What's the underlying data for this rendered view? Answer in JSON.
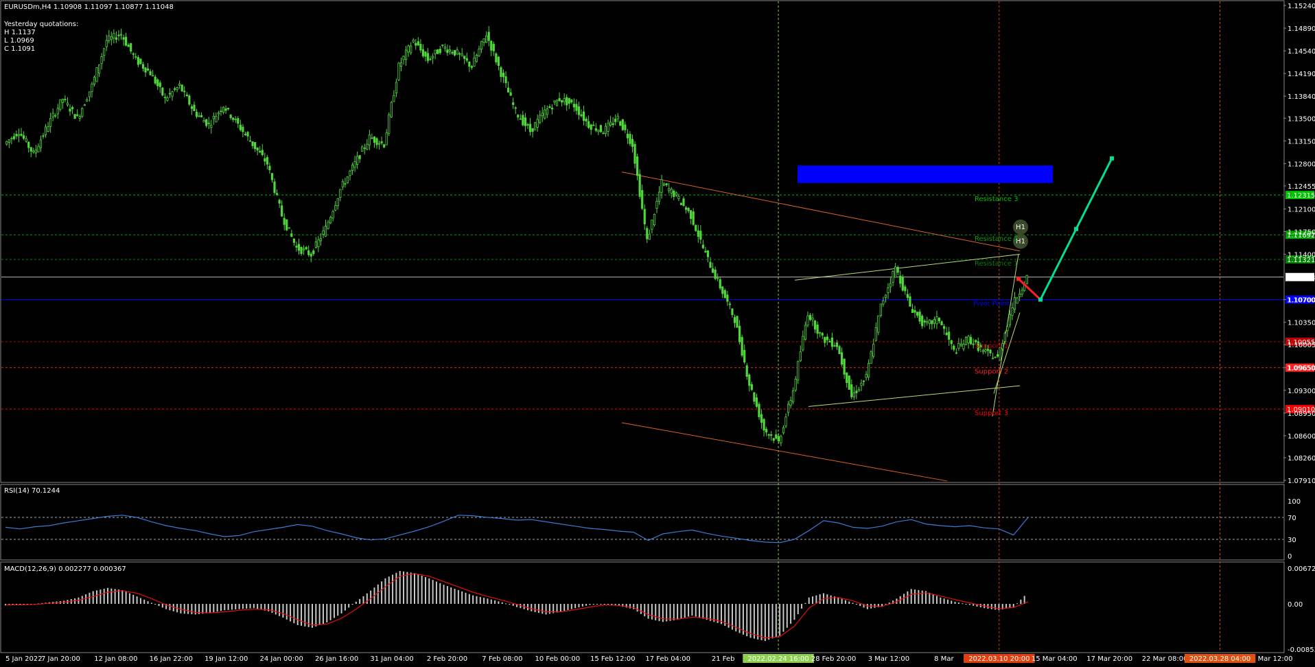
{
  "header": {
    "symbol_line": "EURUSDm,H4  1.10908 1.11097 1.10877 1.11048",
    "yesterday_title": "Yesterday quotations:",
    "yesterday_high": "H 1.1137",
    "yesterday_low": "L 1.0969",
    "yesterday_close": "C 1.1091"
  },
  "chart_data": [
    {
      "type": "candlestick",
      "symbol": "EURUSDm",
      "timeframe": "H4",
      "ohlc_last": {
        "open": 1.10908,
        "high": 1.11097,
        "low": 1.10877,
        "close": 1.11048
      },
      "current_price_label": "1.11048",
      "ylim": [
        1.0791,
        1.1524
      ],
      "price_ticks": [
        "1.15240",
        "1.14890",
        "1.14540",
        "1.14190",
        "1.13840",
        "1.13500",
        "1.13150",
        "1.12800",
        "1.12455",
        "1.12100",
        "1.11750",
        "1.11400",
        "1.11048",
        "1.10700",
        "1.10350",
        "1.10005",
        "1.09650",
        "1.09300",
        "1.08950",
        "1.08600",
        "1.08260",
        "1.07910"
      ],
      "time_ticks": [
        "5 Jan 2022",
        "7 Jan 20:00",
        "12 Jan 08:00",
        "16 Jan 22:00",
        "19 Jan 12:00",
        "24 Jan 00:00",
        "26 Jan 16:00",
        "31 Jan 04:00",
        "2 Feb 20:00",
        "7 Feb 08:00",
        "10 Feb 00:00",
        "15 Feb 12:00",
        "17 Feb 04:00",
        "21 Feb",
        "2022.02.24 16:00",
        "28 Feb 20:00",
        "3 Mar 12:00",
        "8 Mar",
        "2022.03.10 20:00",
        "15 Mar 04:00",
        "17 Mar 20:00",
        "22 Mar 08:00",
        "2022.03.28 04:00",
        "Mar 12:00"
      ],
      "close_series": [
        1.131,
        1.133,
        1.1295,
        1.134,
        1.138,
        1.135,
        1.14,
        1.147,
        1.148,
        1.144,
        1.142,
        1.138,
        1.14,
        1.136,
        1.134,
        1.137,
        1.134,
        1.131,
        1.128,
        1.12,
        1.115,
        1.114,
        1.118,
        1.124,
        1.128,
        1.132,
        1.131,
        1.143,
        1.147,
        1.144,
        1.146,
        1.145,
        1.143,
        1.148,
        1.142,
        1.136,
        1.133,
        1.136,
        1.138,
        1.137,
        1.134,
        1.133,
        1.135,
        1.131,
        1.116,
        1.125,
        1.123,
        1.12,
        1.114,
        1.109,
        1.104,
        1.094,
        1.087,
        1.085,
        1.093,
        1.105,
        1.101,
        1.1,
        1.092,
        1.095,
        1.106,
        1.112,
        1.106,
        1.103,
        1.104,
        1.099,
        1.101,
        1.099,
        1.098,
        1.106,
        1.1105
      ],
      "price_levels": [
        {
          "label": "Resistance 3",
          "value": 1.12315,
          "color": "#00c000"
        },
        {
          "label": "Resistance 2",
          "value": 1.117,
          "color": "#00a000"
        },
        {
          "label": "Resistance 1",
          "value": 1.1132,
          "color": "#008000"
        },
        {
          "label": "Pivot Point",
          "value": 1.107,
          "color": "#0000ff"
        },
        {
          "label": "Support 1",
          "value": 1.1005,
          "color": "#c00000"
        },
        {
          "label": "Support 2",
          "value": 1.0965,
          "color": "#ff2020"
        },
        {
          "label": "Support 3",
          "value": 1.0901,
          "color": "#ff0000"
        }
      ],
      "level_tags": [
        "1.12315",
        "1.11692",
        "1.11321",
        "1.10700",
        "1.10055",
        "1.09650",
        "1.09010"
      ],
      "zone_marker_label": "H1",
      "highlight_zone": {
        "from_time": "2022.02.24 16:00",
        "to_time": "2022.03.10 20:00",
        "price_low": 1.125,
        "price_high": 1.1277,
        "color": "#0000ff"
      },
      "forecast_path": [
        {
          "time": "now",
          "price": 1.1102,
          "color": "#ff2020"
        },
        {
          "time": "next",
          "price": 1.107,
          "color": "#ff2020"
        },
        {
          "time": "later",
          "price": 1.1288,
          "color": "#00e090"
        }
      ],
      "grid": false
    },
    {
      "type": "line",
      "title": "RSI(14) 70.1244",
      "ylim": [
        0,
        100
      ],
      "ticks": [
        "100",
        "70",
        "30",
        "0"
      ],
      "levels": [
        70,
        30
      ],
      "series": [
        {
          "values": [
            52,
            49,
            53,
            55,
            60,
            64,
            68,
            72,
            74,
            70,
            62,
            55,
            50,
            46,
            40,
            35,
            37,
            44,
            48,
            52,
            57,
            54,
            46,
            40,
            33,
            29,
            31,
            38,
            45,
            53,
            63,
            74,
            73,
            70,
            68,
            65,
            66,
            62,
            58,
            54,
            50,
            48,
            45,
            43,
            28,
            40,
            44,
            47,
            41,
            36,
            32,
            28,
            25,
            24,
            30,
            46,
            64,
            60,
            52,
            50,
            54,
            62,
            66,
            58,
            55,
            53,
            55,
            51,
            49,
            38,
            70
          ],
          "color": "#3a7bd5"
        }
      ]
    },
    {
      "type": "bar",
      "title": "MACD(12,26,9) 0.002277 0.000367",
      "ylim": [
        -0.008533,
        0.006723
      ],
      "ticks": [
        "0.006723",
        "0.00",
        "-0.008533"
      ],
      "series": [
        {
          "name": "histogram",
          "values": [
            -0.0003,
            -0.0002,
            0.0,
            0.0003,
            0.0006,
            0.0012,
            0.0024,
            0.003,
            0.0026,
            0.0014,
            0.0002,
            -0.001,
            -0.0018,
            -0.002,
            -0.0017,
            -0.0012,
            -0.001,
            -0.0008,
            -0.0014,
            -0.0026,
            -0.004,
            -0.0045,
            -0.0035,
            -0.0018,
            0.0004,
            0.0025,
            0.0048,
            0.0062,
            0.0058,
            0.0048,
            0.0036,
            0.0026,
            0.0016,
            0.001,
            0.0003,
            -0.0006,
            -0.0014,
            -0.002,
            -0.0015,
            -0.0008,
            -0.0002,
            0.0,
            -0.0004,
            -0.001,
            -0.0028,
            -0.0034,
            -0.003,
            -0.0022,
            -0.003,
            -0.0038,
            -0.0052,
            -0.0064,
            -0.007,
            -0.006,
            -0.003,
            0.0012,
            0.002,
            0.0012,
            0.0002,
            -0.001,
            -0.0005,
            0.001,
            0.0028,
            0.0024,
            0.0012,
            0.0004,
            -0.0002,
            -0.0008,
            -0.0012,
            -0.0006,
            0.0022
          ],
          "color": "#c8c8c8"
        },
        {
          "name": "signal",
          "values": [
            -0.0002,
            -0.0002,
            -0.0001,
            0.0001,
            0.0003,
            0.0007,
            0.0014,
            0.0022,
            0.0025,
            0.002,
            0.001,
            -0.0002,
            -0.001,
            -0.0016,
            -0.0017,
            -0.0015,
            -0.0012,
            -0.001,
            -0.0011,
            -0.0018,
            -0.003,
            -0.004,
            -0.0038,
            -0.0027,
            -0.001,
            0.001,
            0.0032,
            0.0052,
            0.0057,
            0.0052,
            0.0042,
            0.0032,
            0.0022,
            0.0014,
            0.0007,
            -0.0001,
            -0.0009,
            -0.0015,
            -0.0015,
            -0.0011,
            -0.0006,
            -0.0002,
            -0.0003,
            -0.0007,
            -0.002,
            -0.0028,
            -0.0029,
            -0.0025,
            -0.0027,
            -0.0033,
            -0.0044,
            -0.0056,
            -0.0064,
            -0.0062,
            -0.0042,
            -0.0008,
            0.001,
            0.0012,
            0.0006,
            -0.0004,
            -0.0005,
            0.0004,
            0.0018,
            0.0021,
            0.0015,
            0.0008,
            0.0002,
            -0.0004,
            -0.0009,
            -0.0007,
            0.0004
          ],
          "color": "#e01010"
        }
      ]
    }
  ]
}
